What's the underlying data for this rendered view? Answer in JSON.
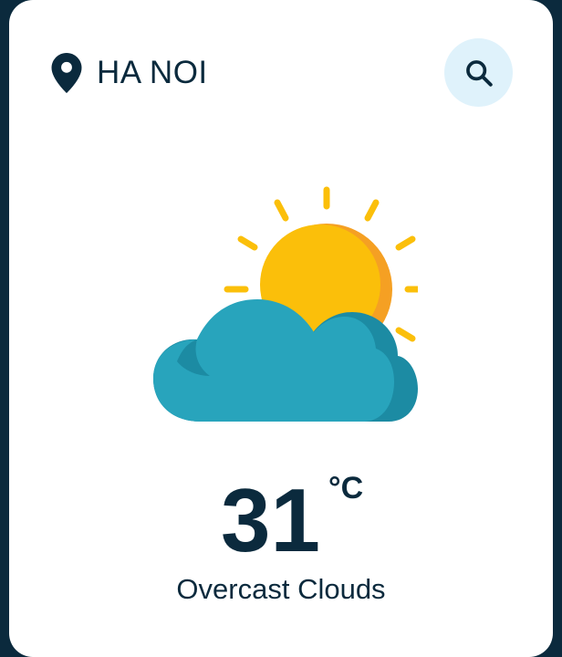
{
  "location": {
    "city": "HA NOI",
    "icon": "map-pin-icon"
  },
  "search": {
    "icon": "search-icon"
  },
  "weather": {
    "icon": "partly-cloudy-sun-icon",
    "temperature": "31",
    "unit": "°C",
    "description": "Overcast Clouds"
  },
  "colors": {
    "background": "#0b2a3d",
    "card": "#ffffff",
    "text": "#0b2a3d",
    "search_bg": "#dff2fb",
    "sun": "#fbbf0a",
    "sun_shade": "#f5a023",
    "cloud": "#28a4bc",
    "cloud_shade": "#1c8ba3"
  }
}
